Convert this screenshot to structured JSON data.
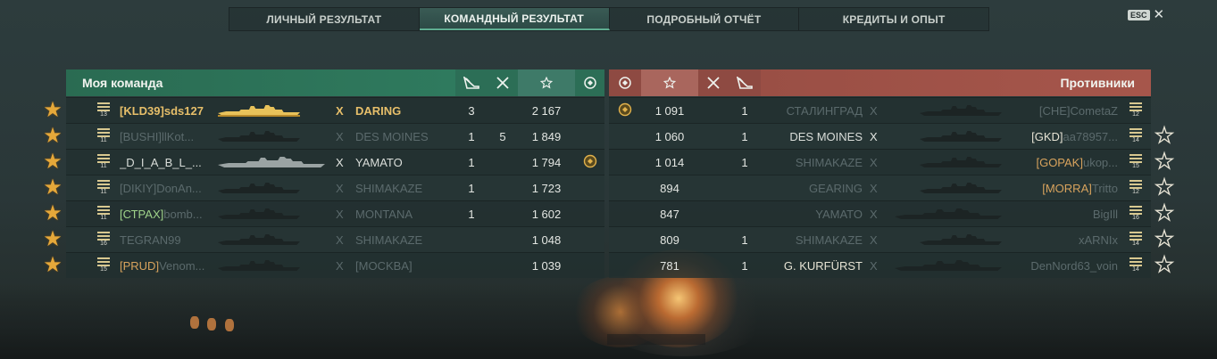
{
  "tabs": [
    {
      "label": "ЛИЧНЫЙ РЕЗУЛЬТАТ"
    },
    {
      "label": "КОМАНДНЫЙ РЕЗУЛЬТАТ"
    },
    {
      "label": "ПОДРОБНЫЙ ОТЧЁТ"
    },
    {
      "label": "КРЕДИТЫ И ОПЫТ"
    }
  ],
  "active_tab": 1,
  "close": {
    "key_label": "ESC",
    "icon": "close-icon"
  },
  "colors": {
    "my_team": "#2f6e56",
    "enemy": "#9a4f45",
    "gold": "#e7bf6a"
  },
  "my_team": {
    "title": "Моя команда",
    "columns": [
      "torpedo-icon",
      "plane-icon",
      "star-icon",
      "badge-icon"
    ],
    "rows": [
      {
        "rank": "13",
        "clan": "[KLD39]",
        "player": "sds127",
        "ship": "DARING",
        "torp": "3",
        "planes": "",
        "xp": "2 167",
        "badge": false,
        "style": "me"
      },
      {
        "rank": "11",
        "clan": "[BUSHI]",
        "player": "llKot...",
        "ship": "DES MOINES",
        "torp": "1",
        "planes": "5",
        "xp": "1 849",
        "badge": false,
        "style": "dead"
      },
      {
        "rank": "11",
        "clan": "",
        "player": "_D_I_A_B_L_...",
        "ship": "YAMATO",
        "torp": "1",
        "planes": "",
        "xp": "1 794",
        "badge": true,
        "style": "alive"
      },
      {
        "rank": "11",
        "clan": "[DIKIY]",
        "player": "DonAn...",
        "ship": "SHIMAKAZE",
        "torp": "1",
        "planes": "",
        "xp": "1 723",
        "badge": false,
        "style": "dead"
      },
      {
        "rank": "11",
        "clan": "[СТРАХ]",
        "player": "bomb...",
        "ship": "MONTANA",
        "torp": "1",
        "planes": "",
        "xp": "1 602",
        "badge": false,
        "style": "dead_green"
      },
      {
        "rank": "16",
        "clan": "",
        "player": "TEGRAN99",
        "ship": "SHIMAKAZE",
        "torp": "",
        "planes": "",
        "xp": "1 048",
        "badge": false,
        "style": "dead"
      },
      {
        "rank": "15",
        "clan": "[PRUD]",
        "player": "Venom...",
        "ship": "[MOCKBA]",
        "torp": "",
        "planes": "",
        "xp": "1 039",
        "badge": false,
        "style": "dead_gold"
      }
    ]
  },
  "enemy": {
    "title": "Противники",
    "columns": [
      "badge-icon",
      "star-icon",
      "plane-icon",
      "torpedo-icon"
    ],
    "rows": [
      {
        "rank": "12",
        "clan": "[CHE]",
        "player": "CometaZ",
        "ship": "СТАЛИНГРАД",
        "torp": "1",
        "planes": "",
        "xp": "1 091",
        "badge": true,
        "style": "dead"
      },
      {
        "rank": "14",
        "clan": "[GKD]",
        "player": "aa78957...",
        "ship": "DES MOINES",
        "torp": "1",
        "planes": "",
        "xp": "1 060",
        "badge": false,
        "style": "alive"
      },
      {
        "rank": "15",
        "clan": "[GOPAK]",
        "player": "ukop...",
        "ship": "SHIMAKAZE",
        "torp": "1",
        "planes": "",
        "xp": "1 014",
        "badge": false,
        "style": "dead_gold"
      },
      {
        "rank": "12",
        "clan": "[MORRA]",
        "player": "Tritto",
        "ship": "GEARING",
        "torp": "",
        "planes": "",
        "xp": "894",
        "badge": false,
        "style": "dead_gold"
      },
      {
        "rank": "16",
        "clan": "",
        "player": "BigIll",
        "ship": "YAMATO",
        "torp": "",
        "planes": "",
        "xp": "847",
        "badge": false,
        "style": "dead"
      },
      {
        "rank": "14",
        "clan": "",
        "player": "xARNIx",
        "ship": "SHIMAKAZE",
        "torp": "1",
        "planes": "",
        "xp": "809",
        "badge": false,
        "style": "dead"
      },
      {
        "rank": "14",
        "clan": "",
        "player": "DenNord63_voin",
        "ship": "G. KURFÜRST",
        "torp": "1",
        "planes": "",
        "xp": "781",
        "badge": false,
        "style": "dead_white"
      }
    ]
  },
  "x_mark": "X"
}
